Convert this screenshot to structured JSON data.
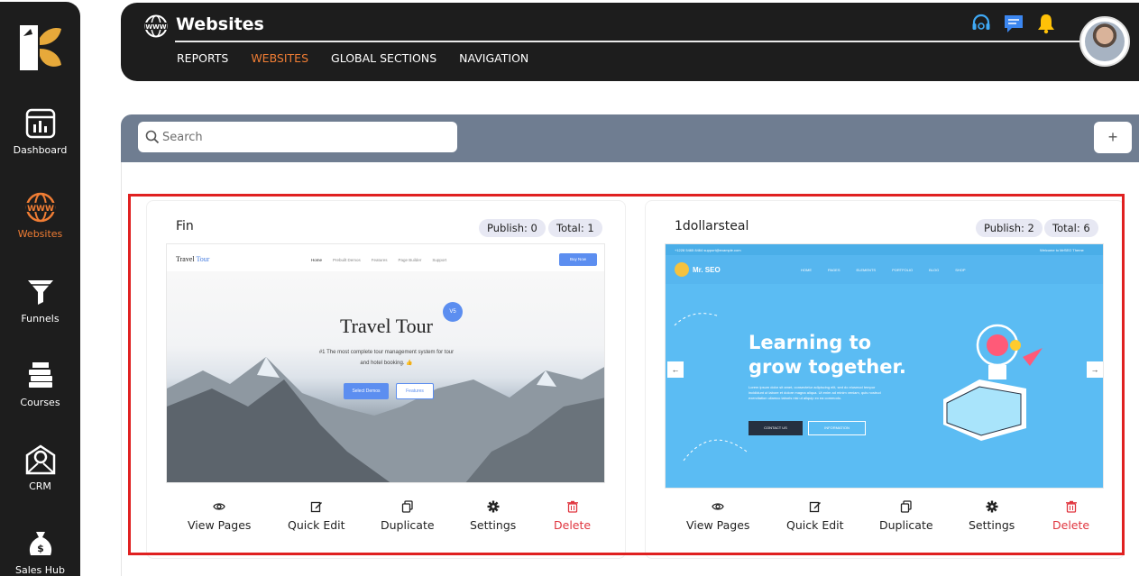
{
  "app": {
    "page_title": "Websites",
    "tabs": [
      {
        "label": "REPORTS",
        "active": false
      },
      {
        "label": "WEBSITES",
        "active": true
      },
      {
        "label": "GLOBAL SECTIONS",
        "active": false
      },
      {
        "label": "NAVIGATION",
        "active": false
      }
    ]
  },
  "sidebar": {
    "items": [
      {
        "label": "Dashboard",
        "icon": "dashboard-icon",
        "active": false
      },
      {
        "label": "Websites",
        "icon": "www-globe-icon",
        "active": true
      },
      {
        "label": "Funnels",
        "icon": "funnel-icon",
        "active": false
      },
      {
        "label": "Courses",
        "icon": "books-icon",
        "active": false
      },
      {
        "label": "CRM",
        "icon": "envelope-gear-icon",
        "active": false
      },
      {
        "label": "Sales Hub",
        "icon": "money-bag-icon",
        "active": false
      }
    ]
  },
  "search": {
    "placeholder": "Search",
    "value": ""
  },
  "add_button": {
    "label": "+"
  },
  "colors": {
    "accent": "#f07d34",
    "sidebar_bg": "#1d1d1d",
    "search_strip": "#6f7d91",
    "highlight": "#e02020",
    "delete": "#e0353e"
  },
  "websites": [
    {
      "name": "Fin",
      "publish": "Publish: 0",
      "total": "Total: 1",
      "preview": {
        "logo_a": "Travel",
        "logo_b": " Tour",
        "menu": [
          "Home",
          "Prebuilt Demos",
          "Features",
          "Page Builder",
          "Support"
        ],
        "buy": "Buy Now",
        "title": "Travel Tour",
        "badge": "V5",
        "sub1": "#1 The most complete tour management system for tour",
        "sub2": "and hotel booking. 👍",
        "btn1": "Select Demos",
        "btn2": "Features"
      }
    },
    {
      "name": "1dollarsteal",
      "publish": "Publish: 2",
      "total": "Total: 6",
      "preview": {
        "top_left": "+1228 5465 8464    support@example.com",
        "top_right": "Welcome to MrSEO Theme",
        "logo": "Mr. SEO",
        "menu": [
          "HOME",
          "PAGES",
          "ELEMENTS",
          "PORTFOLIO",
          "BLOG",
          "SHOP"
        ],
        "headline1": "Learning to",
        "headline2": "grow together.",
        "para": "Lorem ipsum dolor sit amet, consectetur adipiscing elit, sed do eiusmod tempor incididunt ut labore et dolore magna aliqua. Ut enim ad minim veniam, quis nostrud exercitation ullamco laboris nisi ut aliquip ex ea commodo.",
        "btn1": "CONTACT US",
        "btn2": "INFORMATION"
      }
    }
  ],
  "actions": [
    {
      "label": "View Pages",
      "icon": "eye-icon"
    },
    {
      "label": "Quick Edit",
      "icon": "edit-icon"
    },
    {
      "label": "Duplicate",
      "icon": "duplicate-icon"
    },
    {
      "label": "Settings",
      "icon": "gear-icon"
    },
    {
      "label": "Delete",
      "icon": "trash-icon"
    }
  ]
}
